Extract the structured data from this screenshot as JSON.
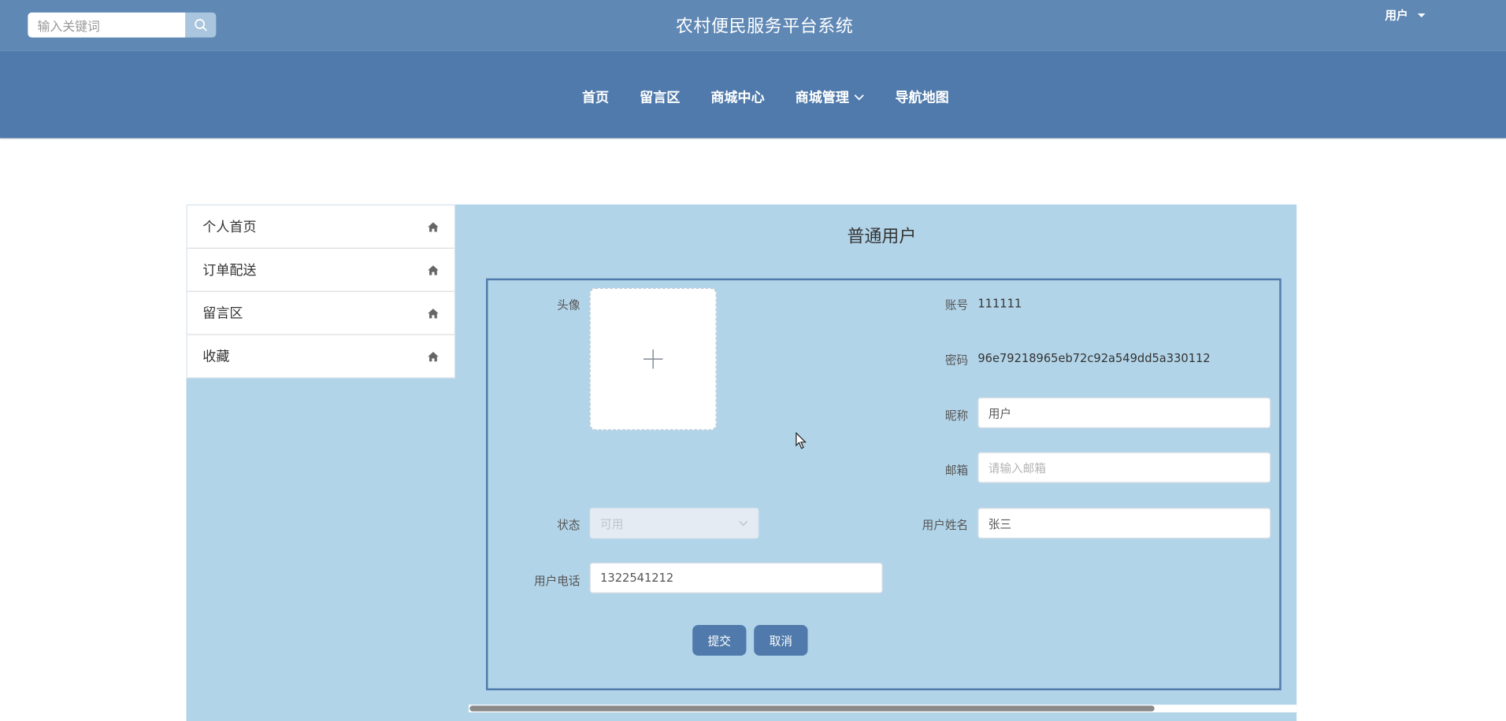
{
  "header": {
    "search_placeholder": "输入关键词",
    "site_title": "农村便民服务平台系统",
    "user_menu_label": "用户"
  },
  "nav": {
    "items": [
      {
        "label": "首页"
      },
      {
        "label": "留言区"
      },
      {
        "label": "商城中心"
      },
      {
        "label": "商城管理"
      },
      {
        "label": "导航地图"
      }
    ]
  },
  "sidebar": {
    "items": [
      {
        "label": "个人首页",
        "icon": "home-icon"
      },
      {
        "label": "订单配送",
        "icon": "home-icon"
      },
      {
        "label": "留言区",
        "icon": "home-icon"
      },
      {
        "label": "收藏",
        "icon": "home-icon"
      }
    ]
  },
  "form": {
    "title": "普通用户",
    "avatar_label": "头像",
    "account_label": "账号",
    "account_value": "111111",
    "password_label": "密码",
    "password_value": "96e79218965eb72c92a549dd5a330112",
    "nickname_label": "昵称",
    "nickname_value": "用户",
    "email_label": "邮箱",
    "email_placeholder": "请输入邮箱",
    "status_label": "状态",
    "status_value": "可用",
    "realname_label": "用户姓名",
    "realname_value": "张三",
    "phone_label": "用户电话",
    "phone_value": "1322541212",
    "submit_label": "提交",
    "cancel_label": "取消"
  },
  "colors": {
    "topbar": "#5f88b5",
    "navbar": "#4f7aab",
    "panel": "#b2d4e8",
    "button": "#4f7aab"
  }
}
